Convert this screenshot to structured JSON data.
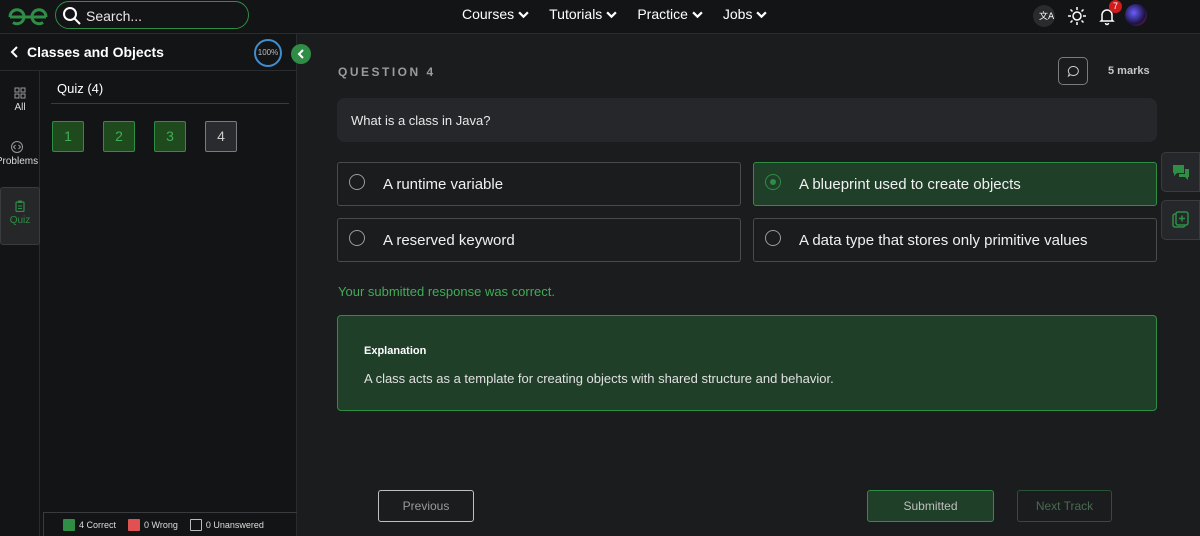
{
  "navbar": {
    "logo_icon": "gfg-logo-icon",
    "search_placeholder": "Search...",
    "menu": [
      {
        "label": "Courses"
      },
      {
        "label": "Tutorials"
      },
      {
        "label": "Practice"
      },
      {
        "label": "Jobs"
      }
    ],
    "notification_count": "7"
  },
  "left_panel": {
    "title": "Classes and Objects",
    "progress": "100%",
    "nav": [
      {
        "label": "All",
        "icon": "grid-icon"
      },
      {
        "label": "Problems",
        "icon": "code-icon"
      },
      {
        "label": "Quiz",
        "icon": "clipboard-icon"
      }
    ],
    "quiz_heading": "Quiz (4)",
    "questions": [
      {
        "number": "1",
        "state": "correct"
      },
      {
        "number": "2",
        "state": "correct"
      },
      {
        "number": "3",
        "state": "correct"
      },
      {
        "number": "4",
        "state": "current"
      }
    ],
    "legend": [
      {
        "label": "4 Correct",
        "color": "#2f8d46"
      },
      {
        "label": "0 Wrong",
        "color": "#e05252"
      },
      {
        "label": "0 Unanswered",
        "color": "transparent"
      }
    ]
  },
  "question": {
    "label": "QUESTION 4",
    "marks": "5 marks",
    "text": "What is a class in Java?",
    "options": [
      {
        "label": "A runtime variable",
        "selected": false
      },
      {
        "label": "A blueprint used to create objects",
        "selected": true
      },
      {
        "label": "A reserved keyword",
        "selected": false
      },
      {
        "label": "A data type that stores only primitive values",
        "selected": false
      }
    ],
    "feedback": "Your submitted response was correct.",
    "explanation_title": "Explanation",
    "explanation_body": "A class acts as a template for creating objects with shared structure and behavior."
  },
  "footer": {
    "previous_label": "Previous",
    "submitted_label": "Submitted",
    "next_label": "Next Track"
  },
  "colors": {
    "accent": "#2f8d46",
    "background": "#1b1c1e",
    "wrong": "#e05252"
  }
}
